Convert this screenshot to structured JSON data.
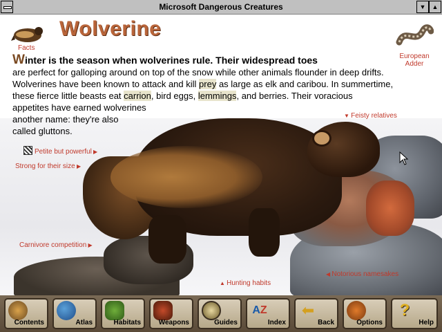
{
  "window": {
    "title": "Microsoft Dangerous Creatures"
  },
  "header": {
    "facts_label": "Facts",
    "title": "Wolverine",
    "european_adder_label_line1": "European",
    "european_adder_label_line2": "Adder"
  },
  "article": {
    "dropcap": "W",
    "lead": "inter is the season when wolverines rule. Their widespread toes",
    "line2": "are perfect for galloping around on top of the snow while other animals flounder in deep drifts.",
    "line3a": "Wolverines have been known to attack and kill ",
    "line3_link": "prey",
    "line3b": " as large as elk and caribou. In summertime,",
    "line4a": "these fierce little beasts eat ",
    "line4_link1": "carrion",
    "line4b": ", bird eggs, ",
    "line4_link2": "lemmings",
    "line4c": ", and berries. Their voracious",
    "line5": "appetites have earned wolverines",
    "line6": "another name: they're also",
    "line7": "called gluttons."
  },
  "topic_links": {
    "feisty_relatives": "Feisty relatives",
    "petite_but_powerful": "Petite but powerful",
    "strong_for_their_size": "Strong for their size",
    "carnivore_competition": "Carnivore competition",
    "hunting_habits": "Hunting habits",
    "notorious_namesakes": "Notorious namesakes"
  },
  "toolbar": {
    "buttons": [
      {
        "label": "Contents",
        "icon": "contents-icon"
      },
      {
        "label": "Atlas",
        "icon": "globe-icon"
      },
      {
        "label": "Habitats",
        "icon": "plant-icon"
      },
      {
        "label": "Weapons",
        "icon": "weapons-icon"
      },
      {
        "label": "Guides",
        "icon": "compass-icon"
      },
      {
        "label": "Index",
        "icon": "index-icon"
      },
      {
        "label": "Back",
        "icon": "back-arrow-icon"
      },
      {
        "label": "Options",
        "icon": "options-icon"
      },
      {
        "label": "Help",
        "icon": "help-icon"
      }
    ]
  },
  "colors": {
    "link_red": "#c0392b",
    "heading_brown": "#b9653a",
    "toolbar_brown": "#5a4a38"
  }
}
